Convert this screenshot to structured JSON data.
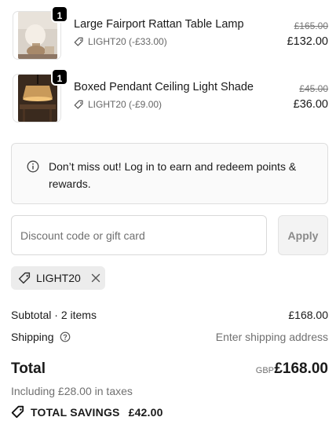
{
  "items": [
    {
      "quantity": "1",
      "name": "Large Fairport Rattan Table Lamp",
      "discount": "LIGHT20 (-£33.00)",
      "original_price": "£165.00",
      "price": "£132.00"
    },
    {
      "quantity": "1",
      "name": "Boxed Pendant Ceiling Light Shade",
      "discount": "LIGHT20 (-£9.00)",
      "original_price": "£45.00",
      "price": "£36.00"
    }
  ],
  "notice": {
    "icon": "info-circle-icon",
    "text": "Don’t miss out! Log in to earn and redeem points & rewards."
  },
  "discount": {
    "placeholder": "Discount code or gift card",
    "value": "",
    "apply_label": "Apply",
    "applied_code": "LIGHT20"
  },
  "summary": {
    "subtotal_label": "Subtotal · 2 items",
    "subtotal_value": "£168.00",
    "shipping_label": "Shipping",
    "shipping_value": "Enter shipping address",
    "total_label": "Total",
    "currency": "GBP",
    "total_value": "£168.00",
    "tax_note": "Including £28.00 in taxes",
    "savings_label": "TOTAL SAVINGS",
    "savings_value": "£42.00"
  },
  "colors": {
    "text": "#1a1a1a",
    "muted": "#707070",
    "badge": "#000000",
    "chip_bg": "#ececec",
    "notice_bg": "#fafafa"
  }
}
